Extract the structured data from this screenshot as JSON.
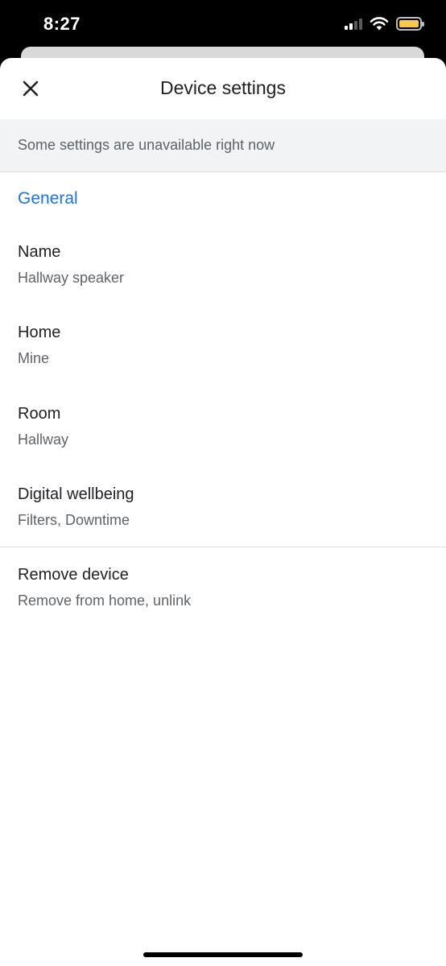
{
  "status_bar": {
    "time": "8:27",
    "icons": [
      "cellular-signal-icon",
      "wifi-icon",
      "battery-icon"
    ],
    "battery_color": "#f6c94a"
  },
  "header": {
    "title": "Device settings",
    "close_icon": "close-icon"
  },
  "banner": {
    "text": "Some settings are unavailable right now"
  },
  "section": {
    "title": "General",
    "accent_color": "#1a73e8"
  },
  "settings": {
    "name": {
      "label": "Name",
      "value": "Hallway speaker"
    },
    "home": {
      "label": "Home",
      "value": "Mine"
    },
    "room": {
      "label": "Room",
      "value": "Hallway"
    },
    "wellbeing": {
      "label": "Digital wellbeing",
      "value": "Filters, Downtime"
    },
    "remove": {
      "label": "Remove device",
      "value": "Remove from home, unlink"
    }
  }
}
